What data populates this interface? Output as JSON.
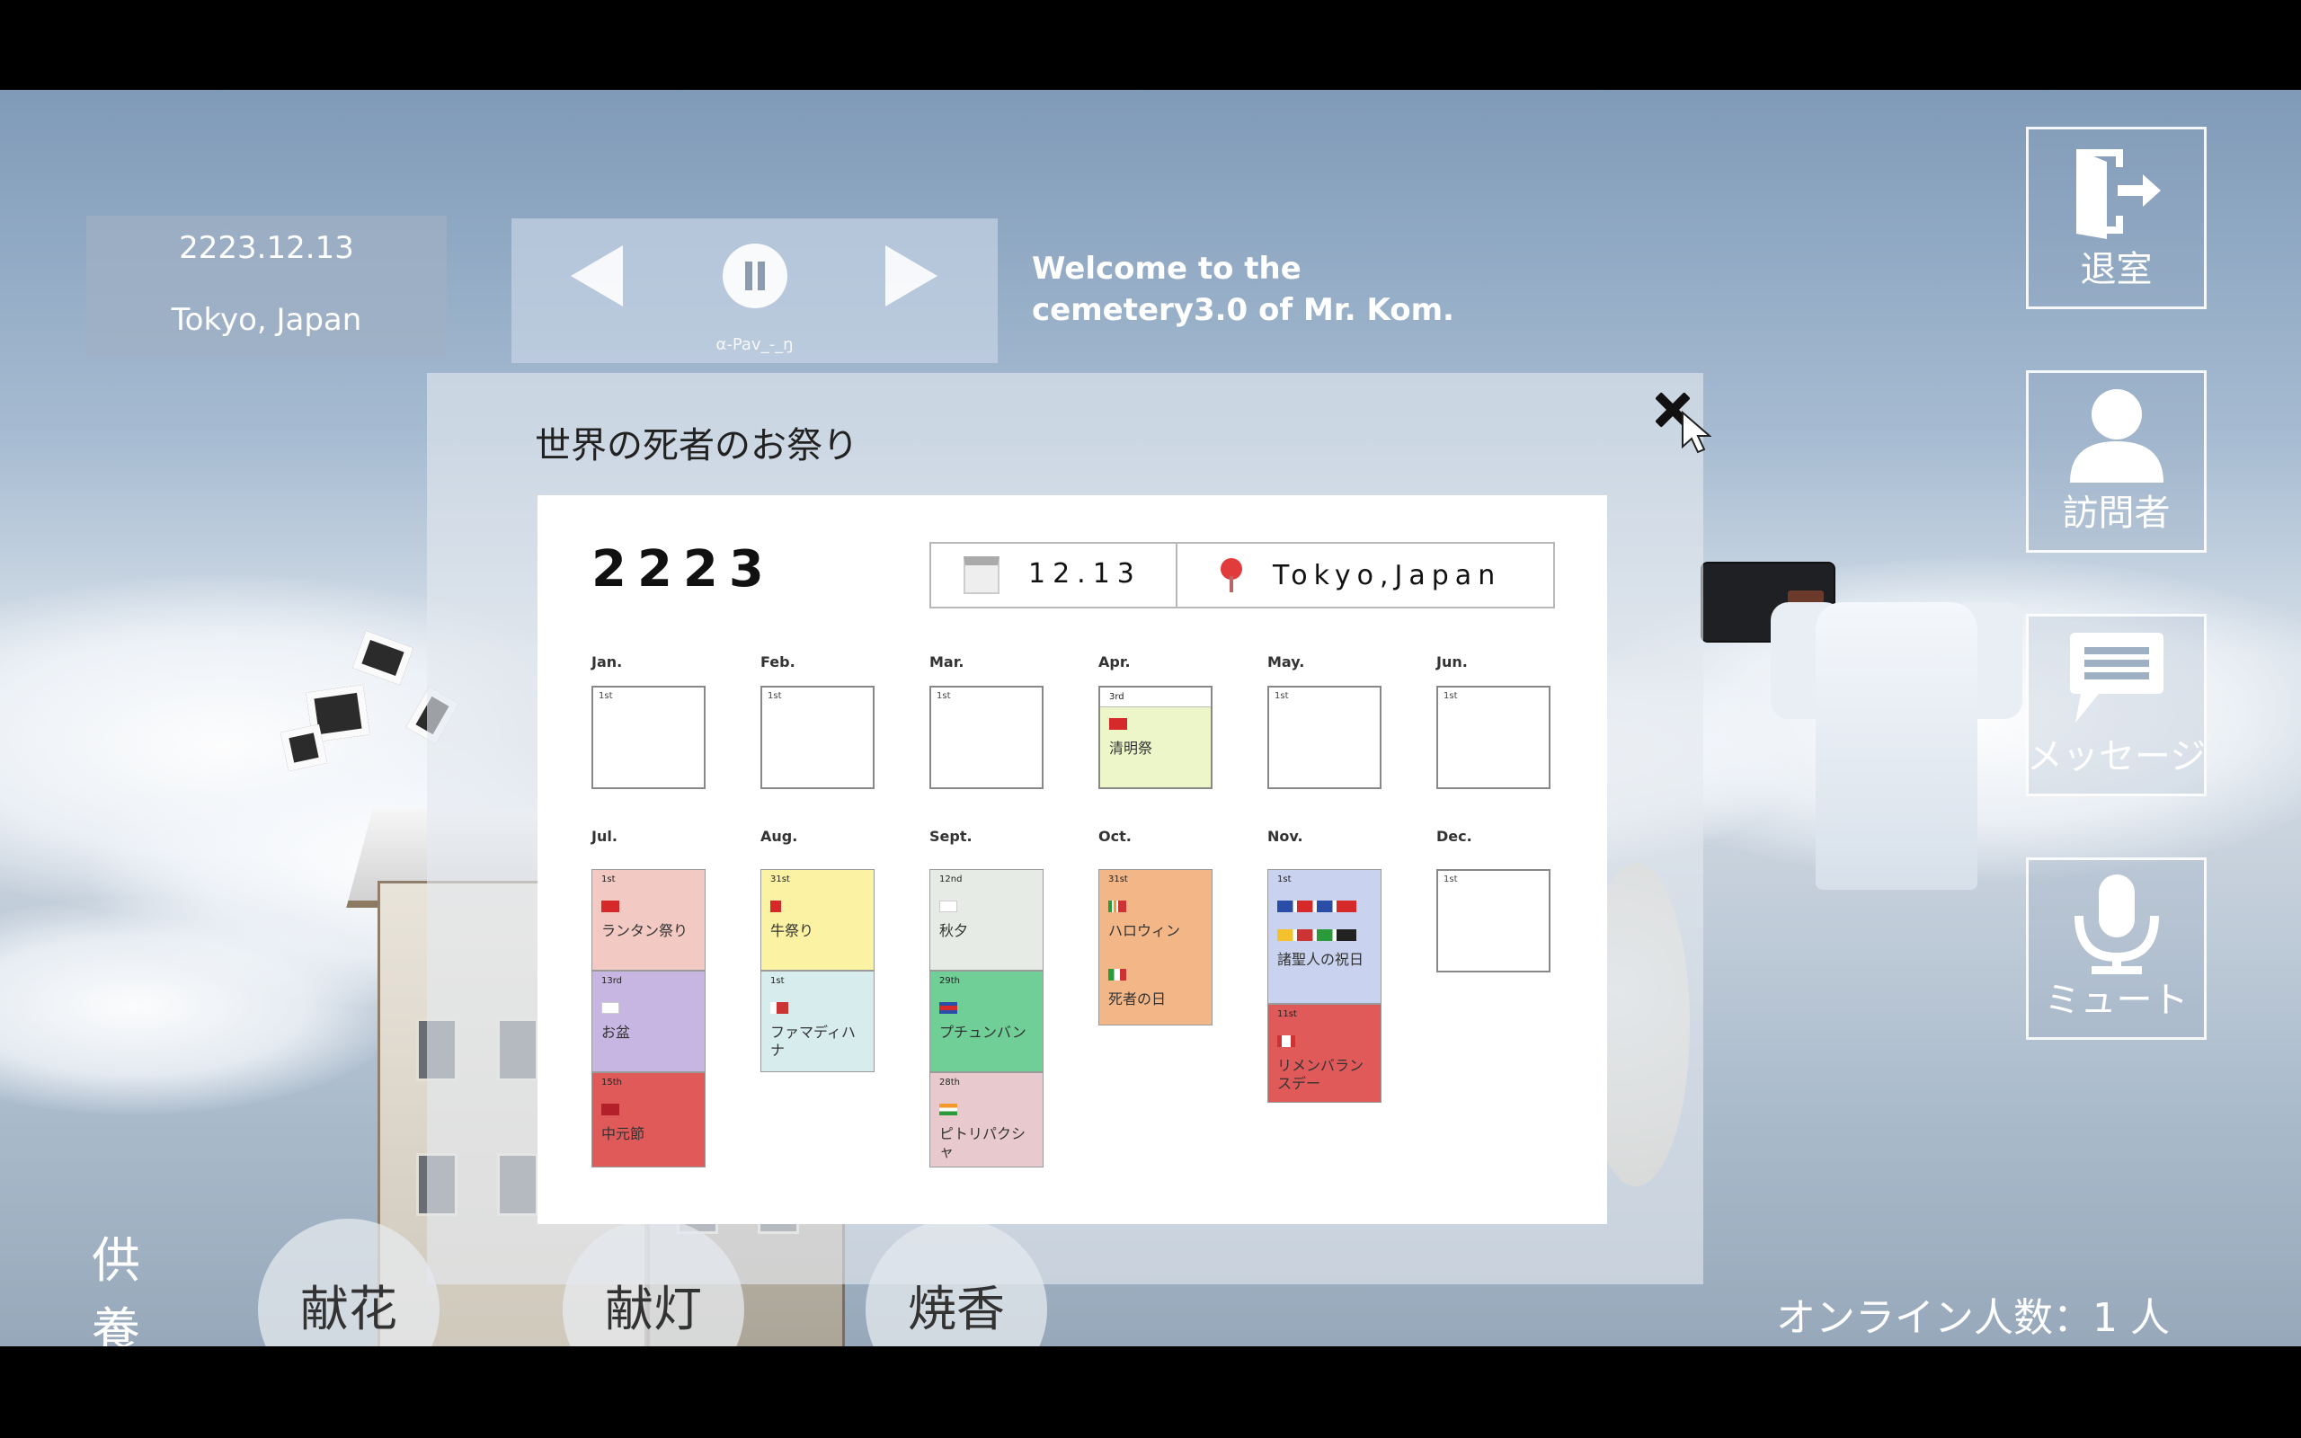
{
  "top_bar": {
    "date": "2223.12.13",
    "location": "Tokyo, Japan"
  },
  "player": {
    "track": "α-Pav_-_ŋ"
  },
  "welcome": "Welcome to the cemetery3.0 of Mr. Kom.",
  "right_menu": {
    "exit": "退室",
    "visitors": "訪問者",
    "message": "メッセージ",
    "mute": "ミュート"
  },
  "offering": {
    "label_line1": "供",
    "label_line2": "養",
    "flower": "献花",
    "lantern": "献灯",
    "incense": "焼香"
  },
  "online": "オンライン人数：1 人",
  "modal": {
    "title": "世界の死者のお祭り",
    "year": "2223",
    "date": "12.13",
    "location": "Tokyo,Japan",
    "months": [
      "Jan.",
      "Feb.",
      "Mar.",
      "Apr.",
      "May.",
      "Jun.",
      "Jul.",
      "Aug.",
      "Sept.",
      "Oct.",
      "Nov.",
      "Dec."
    ],
    "first_tag": "1st",
    "events": {
      "apr": {
        "day": "3rd",
        "name": "清明祭",
        "flag": "flag-china-icon"
      },
      "jul": [
        {
          "day": "1st",
          "name": "ランタン祭り",
          "flag": "flag-hongkong-icon"
        },
        {
          "day": "13rd",
          "name": "お盆",
          "flag": "flag-japan-icon"
        },
        {
          "day": "15th",
          "name": "中元節",
          "flag": "flag-taiwan-icon"
        }
      ],
      "aug": [
        {
          "day": "31st",
          "name": "牛祭り",
          "flag": "flag-nepal-icon"
        },
        {
          "day": "1st",
          "name": "ファマディハナ",
          "flag": "flag-madagascar-icon"
        }
      ],
      "sept": [
        {
          "day": "12nd",
          "name": "秋夕",
          "flag": "flag-korea-icon"
        },
        {
          "day": "29th",
          "name": "プチュンバン",
          "flag": "flag-cambodia-icon"
        },
        {
          "day": "28th",
          "name": "ピトリパクシャ",
          "flag": "flag-india-icon"
        }
      ],
      "oct": [
        {
          "day": "31st",
          "name": "ハロウィン",
          "flag": "flag-ireland-usa-icon"
        },
        {
          "day": "",
          "name": "死者の日",
          "flag": "flag-mexico-icon"
        }
      ],
      "nov": [
        {
          "day": "1st",
          "name": "諸聖人の祝日",
          "flag": "flag-europe-icon"
        },
        {
          "day": "11st",
          "name": "リメンバランスデー",
          "flag": "flag-canada-icon"
        }
      ]
    }
  },
  "colors": {
    "rose": "#f2c9c3",
    "purple": "#c8b6e2",
    "red": "#e05a5a",
    "yellow": "#fbf3a3",
    "mint": "#d7ecec",
    "sage": "#e6ebe5",
    "green": "#6fcf97",
    "pink": "#e8c9cd",
    "orange": "#f3b787",
    "lavender": "#c9d2ee",
    "lime": "#edf6c9"
  }
}
